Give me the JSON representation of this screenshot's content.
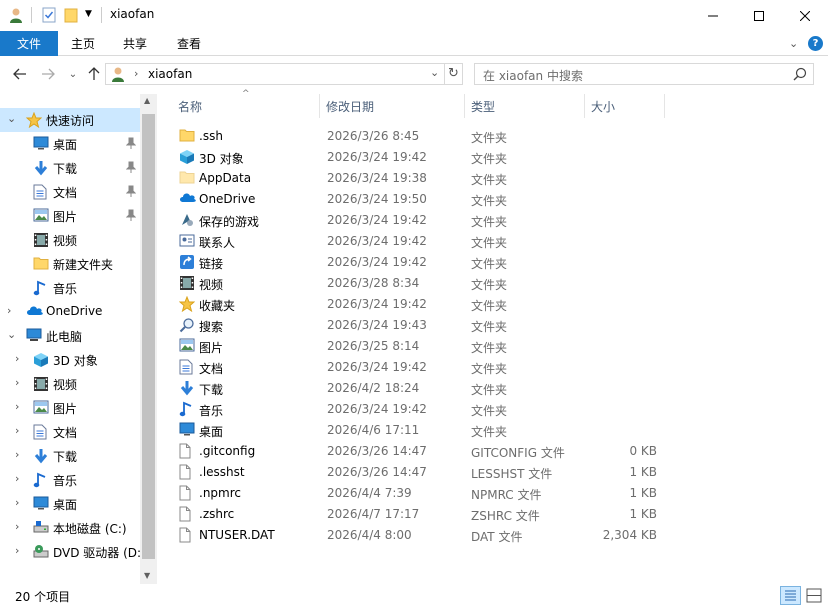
{
  "window": {
    "title": "xiaofan",
    "controls": [
      "minimize",
      "maximize",
      "close"
    ]
  },
  "ribbon": {
    "tabs": [
      {
        "label": "文件",
        "active": true
      },
      {
        "label": "主页"
      },
      {
        "label": "共享"
      },
      {
        "label": "查看"
      }
    ]
  },
  "address": {
    "path": "xiaofan",
    "search_placeholder": "在 xiaofan 中搜索"
  },
  "nav": {
    "items": [
      {
        "label": "快速访问",
        "icon": "star-icon",
        "level": 0,
        "expanded": true,
        "selected": true
      },
      {
        "label": "桌面",
        "icon": "desktop-icon",
        "level": 1,
        "pinned": true
      },
      {
        "label": "下载",
        "icon": "download-icon",
        "level": 1,
        "pinned": true
      },
      {
        "label": "文档",
        "icon": "document-icon",
        "level": 1,
        "pinned": true
      },
      {
        "label": "图片",
        "icon": "pictures-icon",
        "level": 1,
        "pinned": true
      },
      {
        "label": "视频",
        "icon": "video-icon",
        "level": 1
      },
      {
        "label": "新建文件夹",
        "icon": "folder-icon",
        "level": 1
      },
      {
        "label": "音乐",
        "icon": "music-icon",
        "level": 1
      },
      {
        "label": "OneDrive",
        "icon": "cloud-icon",
        "level": 0,
        "expanded": false
      },
      {
        "label": "此电脑",
        "icon": "computer-icon",
        "level": 0,
        "expanded": true
      },
      {
        "label": "3D 对象",
        "icon": "cube-icon",
        "level": 1,
        "expandable": true
      },
      {
        "label": "视频",
        "icon": "video-icon",
        "level": 1,
        "expandable": true
      },
      {
        "label": "图片",
        "icon": "pictures-icon",
        "level": 1,
        "expandable": true
      },
      {
        "label": "文档",
        "icon": "document-icon",
        "level": 1,
        "expandable": true
      },
      {
        "label": "下载",
        "icon": "download-icon",
        "level": 1,
        "expandable": true
      },
      {
        "label": "音乐",
        "icon": "music-icon",
        "level": 1,
        "expandable": true
      },
      {
        "label": "桌面",
        "icon": "desktop-icon",
        "level": 1,
        "expandable": true
      },
      {
        "label": "本地磁盘 (C:)",
        "icon": "drive-icon",
        "level": 1,
        "expandable": true
      },
      {
        "label": "DVD 驱动器 (D:",
        "icon": "dvd-icon",
        "level": 1,
        "expandable": true
      }
    ]
  },
  "list": {
    "columns": [
      "名称",
      "修改日期",
      "类型",
      "大小"
    ],
    "rows": [
      {
        "name": ".ssh",
        "date": "2026/3/26 8:45",
        "type": "文件夹",
        "size": "",
        "icon": "folder-icon"
      },
      {
        "name": "3D 对象",
        "date": "2026/3/24 19:42",
        "type": "文件夹",
        "size": "",
        "icon": "cube-icon"
      },
      {
        "name": "AppData",
        "date": "2026/3/24 19:38",
        "type": "文件夹",
        "size": "",
        "icon": "folder-icon",
        "faded": true
      },
      {
        "name": "OneDrive",
        "date": "2026/3/24 19:50",
        "type": "文件夹",
        "size": "",
        "icon": "cloud-icon"
      },
      {
        "name": "保存的游戏",
        "date": "2026/3/24 19:42",
        "type": "文件夹",
        "size": "",
        "icon": "games-icon"
      },
      {
        "name": "联系人",
        "date": "2026/3/24 19:42",
        "type": "文件夹",
        "size": "",
        "icon": "contacts-icon"
      },
      {
        "name": "链接",
        "date": "2026/3/24 19:42",
        "type": "文件夹",
        "size": "",
        "icon": "link-icon"
      },
      {
        "name": "视频",
        "date": "2026/3/28 8:34",
        "type": "文件夹",
        "size": "",
        "icon": "video-icon"
      },
      {
        "name": "收藏夹",
        "date": "2026/3/24 19:42",
        "type": "文件夹",
        "size": "",
        "icon": "star-icon"
      },
      {
        "name": "搜索",
        "date": "2026/3/24 19:43",
        "type": "文件夹",
        "size": "",
        "icon": "search-icon"
      },
      {
        "name": "图片",
        "date": "2026/3/25 8:14",
        "type": "文件夹",
        "size": "",
        "icon": "pictures-icon"
      },
      {
        "name": "文档",
        "date": "2026/3/24 19:42",
        "type": "文件夹",
        "size": "",
        "icon": "document-icon"
      },
      {
        "name": "下载",
        "date": "2026/4/2 18:24",
        "type": "文件夹",
        "size": "",
        "icon": "download-icon"
      },
      {
        "name": "音乐",
        "date": "2026/3/24 19:42",
        "type": "文件夹",
        "size": "",
        "icon": "music-icon"
      },
      {
        "name": "桌面",
        "date": "2026/4/6 17:11",
        "type": "文件夹",
        "size": "",
        "icon": "desktop-icon"
      },
      {
        "name": ".gitconfig",
        "date": "2026/3/26 14:47",
        "type": "GITCONFIG 文件",
        "size": "0 KB",
        "icon": "file-icon"
      },
      {
        "name": ".lesshst",
        "date": "2026/3/26 14:47",
        "type": "LESSHST 文件",
        "size": "1 KB",
        "icon": "file-icon"
      },
      {
        "name": ".npmrc",
        "date": "2026/4/4 7:39",
        "type": "NPMRC 文件",
        "size": "1 KB",
        "icon": "file-icon"
      },
      {
        "name": ".zshrc",
        "date": "2026/4/7 17:17",
        "type": "ZSHRC 文件",
        "size": "1 KB",
        "icon": "file-icon"
      },
      {
        "name": "NTUSER.DAT",
        "date": "2026/4/4 8:00",
        "type": "DAT 文件",
        "size": "2,304 KB",
        "icon": "file-icon"
      }
    ]
  },
  "status": {
    "count": "20 个项目"
  },
  "colors": {
    "accent": "#1979ca",
    "selection": "#cce8ff",
    "folder": "#ffd769"
  }
}
